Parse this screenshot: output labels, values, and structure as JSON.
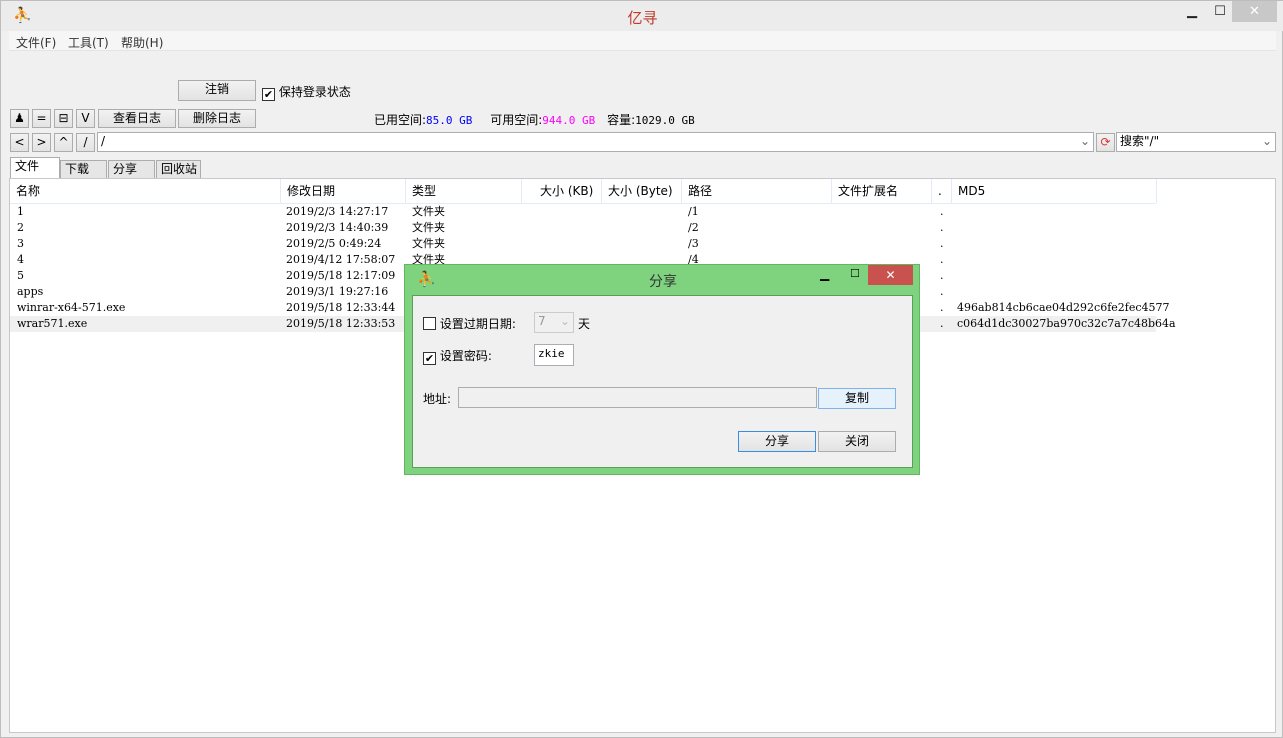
{
  "window": {
    "title": "亿寻",
    "app_icon": "runner-icon",
    "minimize": "▁",
    "maximize": "☐",
    "close": "✕"
  },
  "menu": [
    "文件(F)",
    "工具(T)",
    "帮助(H)"
  ],
  "account": {
    "logout": "注销",
    "keep_login": "保持登录状态",
    "keep_login_checked": true
  },
  "toolbar": {
    "b1": "♟",
    "b2": "=",
    "b3": "⊟",
    "b4": "V",
    "view_log": "查看日志",
    "delete_log": "删除日志"
  },
  "storage": {
    "used_label": "已用空间:",
    "used": "85.0 GB",
    "free_label": "可用空间:",
    "free": "944.0 GB",
    "cap_label": "容量:",
    "cap": "1029.0 GB",
    "used_color": "#0000ff",
    "free_color": "#ff00ff"
  },
  "nav": {
    "back": "<",
    "forward": ">",
    "up": "^",
    "root": "/",
    "path": "/",
    "search": "搜索\"/\""
  },
  "tabs": [
    "文件",
    "下载",
    "分享",
    "回收站"
  ],
  "columns": [
    "名称",
    "修改日期",
    "类型",
    "大小 (KB)",
    "大小 (Byte)",
    "路径",
    "文件扩展名",
    ".",
    "MD5"
  ],
  "rows": [
    {
      "name": "1",
      "date": "2019/2/3 14:27:17",
      "type": "文件夹",
      "path": "/1",
      "dot": ".",
      "md5": ""
    },
    {
      "name": "2",
      "date": "2019/2/3 14:40:39",
      "type": "文件夹",
      "path": "/2",
      "dot": ".",
      "md5": ""
    },
    {
      "name": "3",
      "date": "2019/2/5 0:49:24",
      "type": "文件夹",
      "path": "/3",
      "dot": ".",
      "md5": ""
    },
    {
      "name": "4",
      "date": "2019/4/12 17:58:07",
      "type": "文件夹",
      "path": "/4",
      "dot": ".",
      "md5": ""
    },
    {
      "name": "5",
      "date": "2019/5/18 12:17:09",
      "type": "",
      "path": "",
      "dot": ".",
      "md5": ""
    },
    {
      "name": "apps",
      "date": "2019/3/1 19:27:16",
      "type": "",
      "path": "",
      "dot": ".",
      "md5": ""
    },
    {
      "name": "winrar-x64-571.exe",
      "date": "2019/5/18 12:33:44",
      "type": "",
      "path": "",
      "dot": ".",
      "md5": "496ab814cb6cae04d292c6fe2fec4577"
    },
    {
      "name": "wrar571.exe",
      "date": "2019/5/18 12:33:53",
      "type": "",
      "path": "",
      "dot": ".",
      "md5": "c064d1dc30027ba970c32c7a7c48b64a"
    }
  ],
  "dialog": {
    "title": "分享",
    "expire_label": "设置过期日期:",
    "expire_checked": false,
    "expire_value": "7",
    "expire_unit": "天",
    "pwd_label": "设置密码:",
    "pwd_checked": true,
    "pwd_value": "zkie",
    "addr_label": "地址:",
    "addr_value": "",
    "copy": "复制",
    "share": "分享",
    "close": "关闭"
  }
}
